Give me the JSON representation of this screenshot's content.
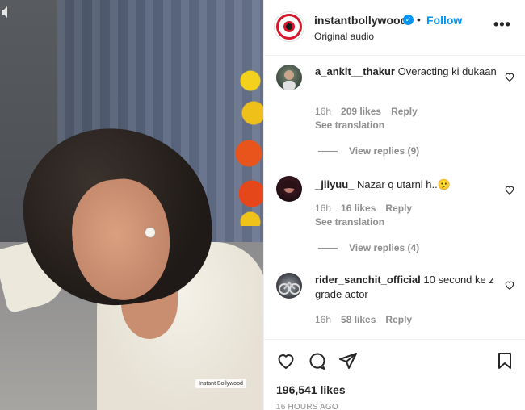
{
  "media": {
    "watermark": "Instant Bollywood"
  },
  "header": {
    "username": "instantbollywood",
    "separator": "•",
    "follow_label": "Follow",
    "audio_label": "Original audio",
    "more_label": "•••"
  },
  "comments": [
    {
      "username": "a_ankit__thakur",
      "text": "Overacting ki dukaan",
      "time": "16h",
      "likes": "209 likes",
      "reply_label": "Reply",
      "translation_label": "See translation",
      "view_replies": "View replies (9)"
    },
    {
      "username": "_jiiyuu_",
      "text": "Nazar q utarni h..🫤",
      "time": "16h",
      "likes": "16 likes",
      "reply_label": "Reply",
      "translation_label": "See translation",
      "view_replies": "View replies (4)"
    },
    {
      "username": "rider_sanchit_official",
      "text": "10 second ke z grade actor",
      "time": "16h",
      "likes": "58 likes",
      "reply_label": "Reply"
    }
  ],
  "actions": {
    "likes_count": "196,541 likes",
    "timestamp": "16 HOURS AGO"
  },
  "icons": {
    "verified": "verified-badge-icon",
    "heart": "heart-icon",
    "comment": "comment-icon",
    "share": "share-icon",
    "save": "bookmark-icon"
  },
  "colors": {
    "accent": "#0095f6",
    "brand_red": "#d5192b",
    "muted": "#8e8e8e"
  }
}
